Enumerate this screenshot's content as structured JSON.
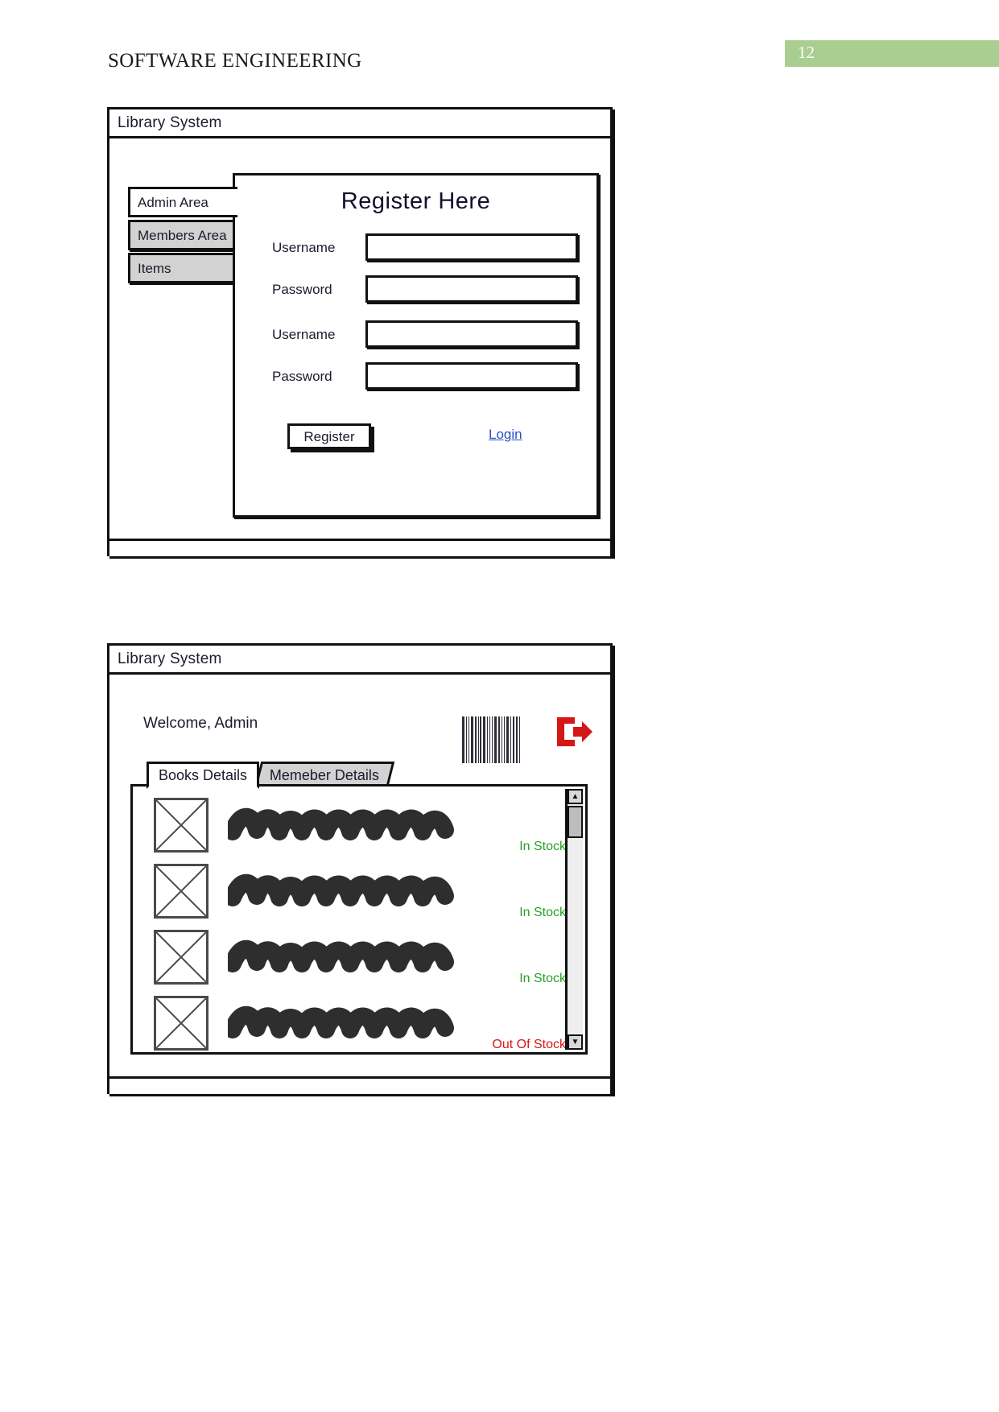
{
  "document": {
    "header_title": "SOFTWARE ENGINEERING",
    "page_number": "12",
    "badge_color": "#a9ce8f"
  },
  "register_window": {
    "title": "Library System",
    "sidebar": {
      "items": [
        {
          "label": "Admin Area",
          "active": true
        },
        {
          "label": "Members Area",
          "active": false
        },
        {
          "label": "Items",
          "active": false
        }
      ]
    },
    "panel": {
      "heading": "Register Here",
      "fields": [
        {
          "label": "Username",
          "value": "",
          "placeholder": ""
        },
        {
          "label": "Password",
          "value": "",
          "placeholder": ""
        },
        {
          "label": "Username",
          "value": "",
          "placeholder": ""
        },
        {
          "label": "Password",
          "value": "",
          "placeholder": ""
        }
      ],
      "register_button": "Register",
      "login_link": "Login",
      "login_link_color": "#2a50c8"
    }
  },
  "dashboard_window": {
    "title": "Library System",
    "welcome": "Welcome, Admin",
    "barcode_icon": "barcode-icon",
    "logout_icon": "logout-icon",
    "logout_icon_color": "#d41717",
    "tabs": [
      {
        "label": "Books Details",
        "active": true
      },
      {
        "label": "Memeber Details",
        "active": false
      }
    ],
    "books": [
      {
        "thumbnail": "image-placeholder-icon",
        "title": "",
        "stock": "In Stock",
        "stock_state": "in"
      },
      {
        "thumbnail": "image-placeholder-icon",
        "title": "",
        "stock": "In Stock",
        "stock_state": "in"
      },
      {
        "thumbnail": "image-placeholder-icon",
        "title": "",
        "stock": "In Stock",
        "stock_state": "in"
      },
      {
        "thumbnail": "image-placeholder-icon",
        "title": "",
        "stock": "Out Of Stock",
        "stock_state": "out"
      }
    ],
    "stock_colors": {
      "in": "#27a026",
      "out": "#d41717"
    },
    "scrollbar": {
      "up": "▲",
      "down": "▼"
    }
  }
}
